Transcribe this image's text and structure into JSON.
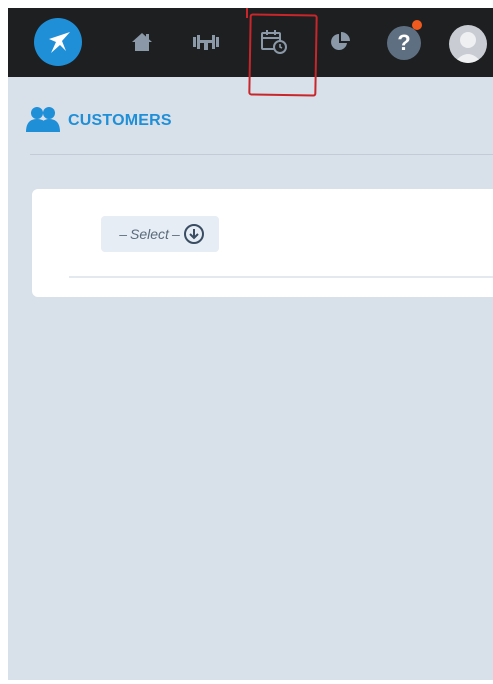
{
  "topbar": {
    "nav": [
      {
        "icon": "home-icon"
      },
      {
        "icon": "dumbbell-icon"
      },
      {
        "icon": "calendar-clock-icon"
      },
      {
        "icon": "pie-chart-icon"
      }
    ],
    "help_label": "?",
    "help_badge_color": "#f05a1e",
    "accent_color": "#1f8fd8"
  },
  "section": {
    "title": "CUSTOMERS",
    "icon": "users-icon"
  },
  "card": {
    "select": {
      "dash_left": "–",
      "label": "Select",
      "dash_right": "–"
    }
  }
}
